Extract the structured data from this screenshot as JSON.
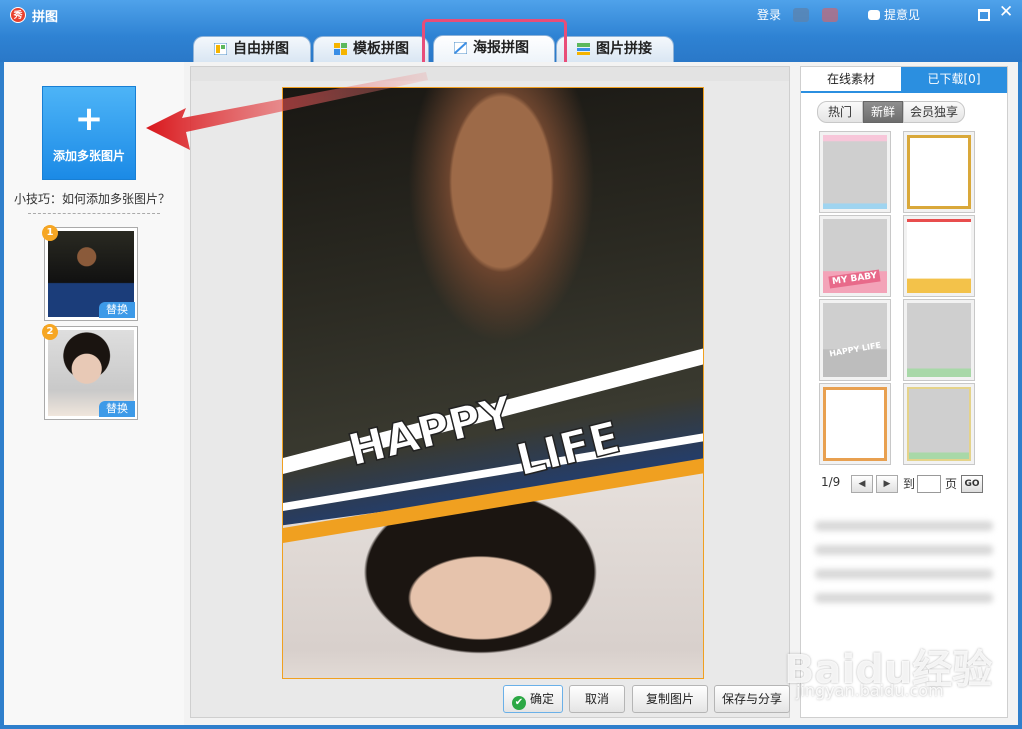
{
  "window": {
    "title": "拼图",
    "logo_text": "秀",
    "login_label": "登录",
    "feedback_label": "提意见"
  },
  "tabs": [
    {
      "label": "自由拼图",
      "icon": "free-collage-icon",
      "active": false
    },
    {
      "label": "模板拼图",
      "icon": "template-collage-icon",
      "active": false
    },
    {
      "label": "海报拼图",
      "icon": "poster-collage-icon",
      "active": true
    },
    {
      "label": "图片拼接",
      "icon": "image-stitch-icon",
      "active": false
    }
  ],
  "left_panel": {
    "add_plus": "+",
    "add_label": "添加多张图片",
    "tip": "小技巧：如何添加多张图片？",
    "thumbnails": [
      {
        "number": "1",
        "replace_label": "替换"
      },
      {
        "number": "2",
        "replace_label": "替换"
      }
    ]
  },
  "poster": {
    "line1": "HAPPY",
    "line2": "LIFE"
  },
  "actions": {
    "ok": "确定",
    "cancel": "取消",
    "copy": "复制图片",
    "save_share": "保存与分享"
  },
  "right_panel": {
    "tab_online": "在线素材",
    "tab_downloaded": "已下载[0]",
    "filters": [
      "热门",
      "新鲜",
      "会员独享"
    ],
    "active_filter": "新鲜",
    "template_texts": [
      "MY BABY",
      "HAPPY LIFE"
    ],
    "pager": {
      "page": "1/9",
      "go_to": "到",
      "page_unit": "页",
      "go": "GO"
    }
  },
  "watermark": {
    "text": "Baidu经验",
    "sub": "jingyan.baidu.com"
  },
  "colors": {
    "title_bar": "#2e82d3",
    "accent_blue": "#2b8fe0",
    "highlight": "#e84d78",
    "arrow": "#e3262b",
    "poster_orange": "#f0a020",
    "badge": "#f6a623"
  }
}
